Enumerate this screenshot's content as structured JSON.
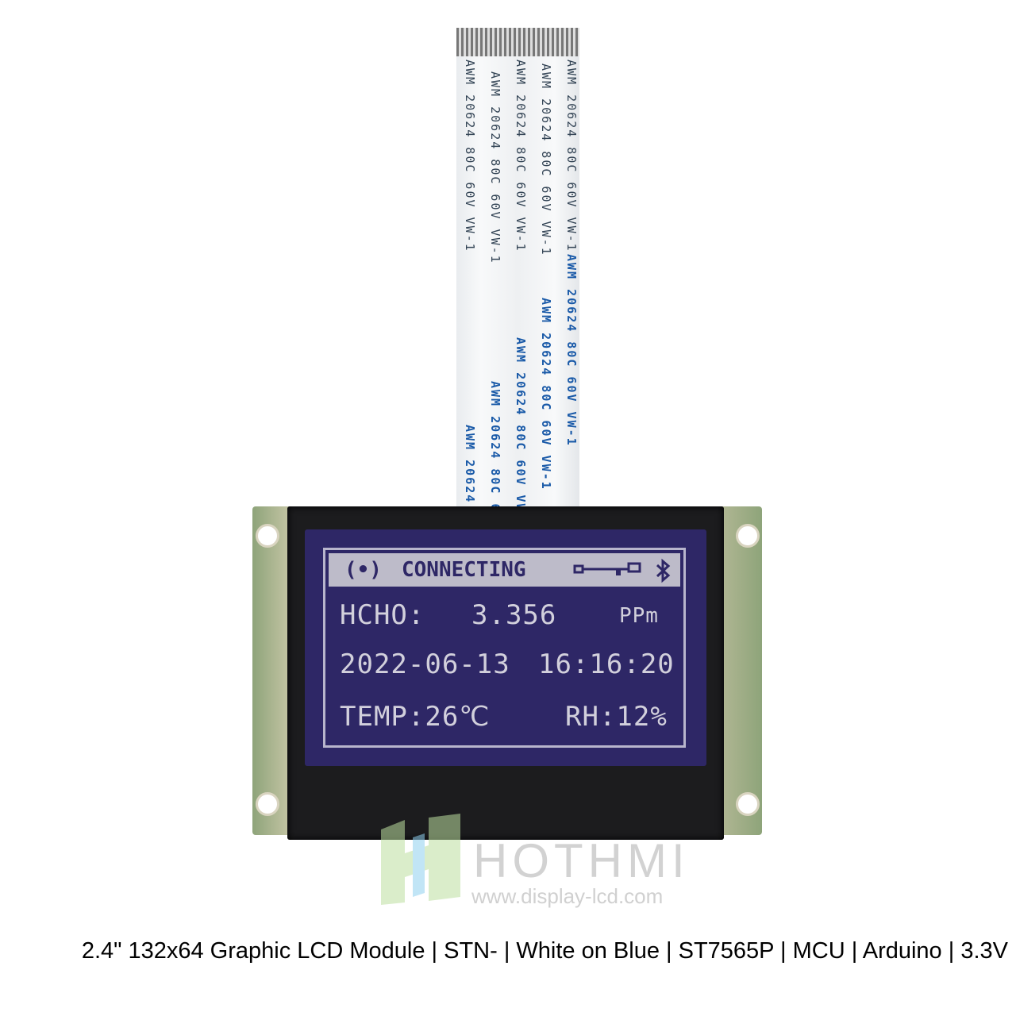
{
  "cable": {
    "marking": "AWM 20624 80C 60V VW-1"
  },
  "lcd": {
    "header": {
      "status": "CONNECTING",
      "signal_icon": "(•)",
      "link_icon": "connection-link",
      "bluetooth_icon": "bluetooth"
    },
    "hcho_label": "HCHO:",
    "hcho_value": "3.356",
    "hcho_unit": "PPm",
    "date": "2022-06-13",
    "time": "16:16:20",
    "temp": "TEMP:26℃",
    "rh": "RH:12%"
  },
  "colors": {
    "lcd_background": "#2e2766",
    "lcd_text": "#d2d0dc"
  },
  "watermark": {
    "brand": "HOTHMI",
    "url": "www.display-lcd.com"
  },
  "caption": "2.4\" 132x64 Graphic LCD Module | STN- | White on Blue | ST7565P | MCU | Arduino | 3.3V"
}
